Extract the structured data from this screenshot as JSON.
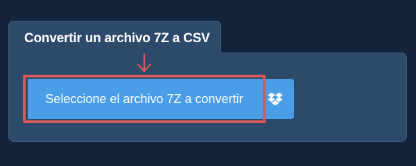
{
  "converter": {
    "title": "Convertir un archivo 7Z a CSV",
    "select_button_label": "Seleccione el archivo 7Z a convertir"
  },
  "icons": {
    "dropbox": "dropbox-icon",
    "arrow": "arrow-down-icon"
  },
  "colors": {
    "background": "#13243a",
    "panel": "#2d4a6b",
    "button": "#4a9ee8",
    "highlight": "#d75a5a"
  }
}
